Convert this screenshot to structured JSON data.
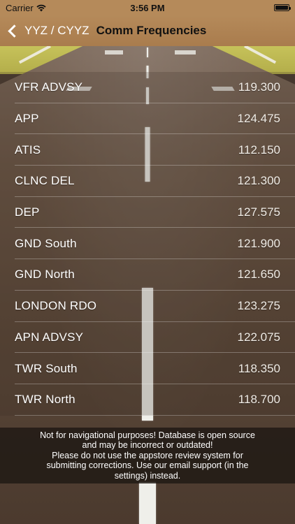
{
  "status_bar": {
    "carrier": "Carrier",
    "time": "3:56 PM",
    "icons": [
      "wifi-icon",
      "battery-icon"
    ]
  },
  "nav": {
    "back_label": "YYZ / CYYZ",
    "title": "Comm Frequencies"
  },
  "frequencies": [
    {
      "name": "VFR ADVSY",
      "value": "119.300"
    },
    {
      "name": "APP",
      "value": "124.475"
    },
    {
      "name": "ATIS",
      "value": "112.150"
    },
    {
      "name": "CLNC DEL",
      "value": "121.300"
    },
    {
      "name": "DEP",
      "value": "127.575"
    },
    {
      "name": "GND South",
      "value": "121.900"
    },
    {
      "name": "GND North",
      "value": "121.650"
    },
    {
      "name": "LONDON RDO",
      "value": "123.275"
    },
    {
      "name": "APN ADVSY",
      "value": "122.075"
    },
    {
      "name": "TWR South",
      "value": "118.350"
    },
    {
      "name": "TWR North",
      "value": "118.700"
    }
  ],
  "disclaimer": "Not for navigational purposes! Database is open source\nand may be incorrect or outdated!\nPlease do not use the appstore review system for\nsubmitting corrections. Use our email support (in the\nsettings) instead.",
  "colors": {
    "nav_background": "#b58a5a",
    "text": "#ffffff",
    "title_text": "#111111",
    "disclaimer_background": "#1e1814"
  }
}
